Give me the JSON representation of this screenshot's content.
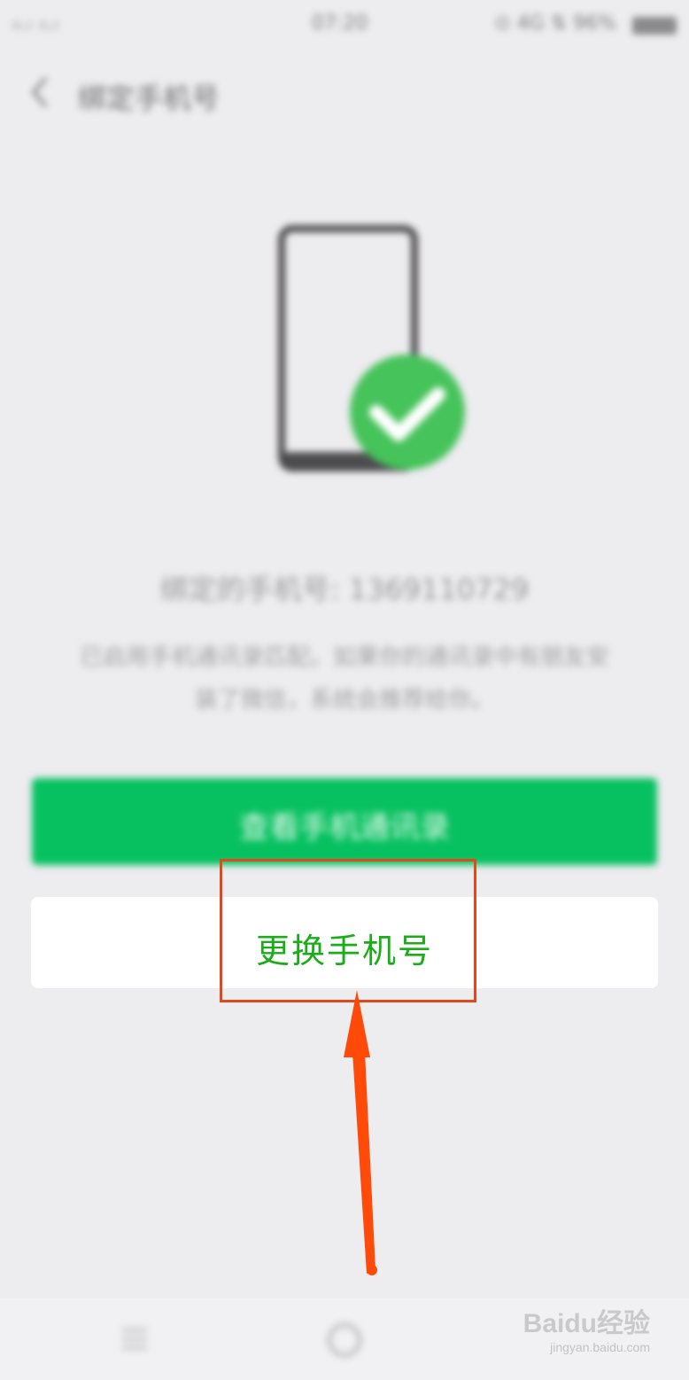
{
  "status_bar": {
    "signal": "ᵢₗ.ₗ ᵢₗ.ₗ",
    "time": "07:20",
    "right": "⊙ 4G ⇅ 96%"
  },
  "nav": {
    "title": "绑定手机号"
  },
  "main": {
    "bound_number": "绑定的手机号: 1369110729",
    "description_line1": "已启用手机通讯录匹配。如果你的通讯录中有朋友安",
    "description_line2": "装了微信，系统会推荐给你。",
    "view_contacts_label": "查看手机通讯录",
    "change_phone_label": "更换手机号"
  },
  "colors": {
    "wechat_green": "#07c160",
    "text_green": "#1aad19",
    "annotation": "#e4471c",
    "arrow": "#ff4a0a"
  },
  "watermark": {
    "logo": "Bai",
    "logo_tail": "经验",
    "url": "jingyan.baidu.com"
  }
}
